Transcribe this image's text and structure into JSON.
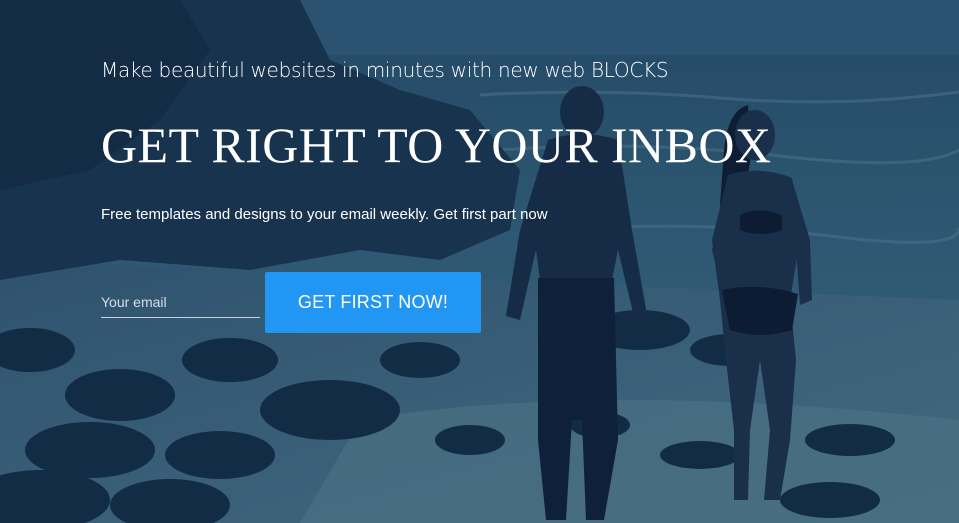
{
  "hero": {
    "tagline": "Make beautiful websites in minutes with new web BLOCKS",
    "headline": "GET RIGHT TO YOUR INBOX",
    "subline": "Free templates and designs to your email weekly. Get first part now",
    "background_icon": "beach-couple-photo"
  },
  "signup": {
    "email_placeholder": "Your email",
    "email_value": "",
    "button_label": "GET FIRST NOW!"
  },
  "colors": {
    "overlay": "#12285a",
    "button": "#2196f3",
    "text": "#ffffff"
  }
}
